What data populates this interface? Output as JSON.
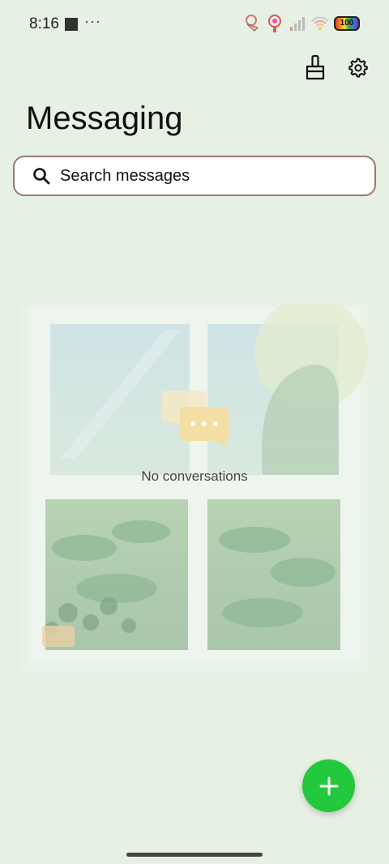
{
  "status_bar": {
    "time": "8:16",
    "more": "···",
    "battery": "100"
  },
  "header": {
    "title": "Messaging",
    "clean_icon": "broom-icon",
    "settings_icon": "gear-icon"
  },
  "search": {
    "placeholder": "Search messages"
  },
  "empty_state": {
    "text": "No conversations"
  },
  "fab": {
    "icon": "plus-icon",
    "color": "#22c93c"
  },
  "colors": {
    "background": "#e6f0e3",
    "search_border": "#9a7a70"
  }
}
